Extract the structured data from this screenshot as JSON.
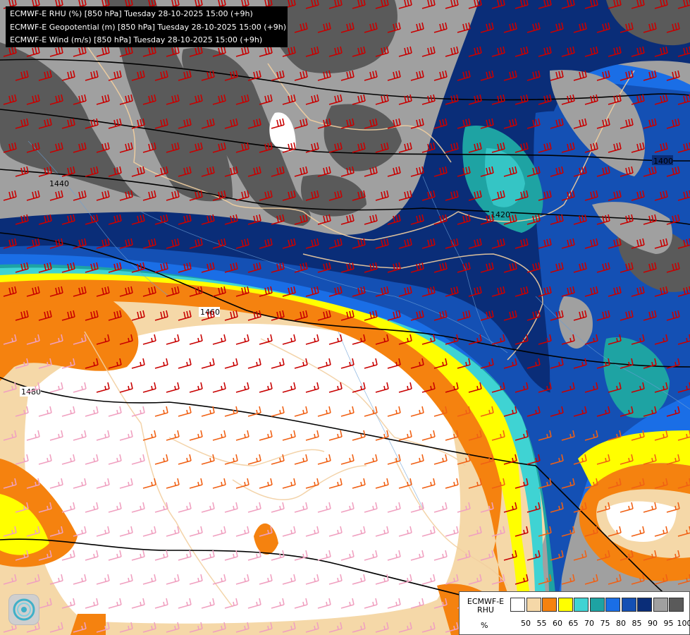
{
  "header": {
    "lines": [
      "ECMWF-E RHU (%) [850 hPa] Tuesday 28-10-2025 15:00 (+9h)",
      "ECMWF-E Geopotential (m) [850 hPa] Tuesday 28-10-2025 15:00 (+9h)",
      "ECMWF-E Wind (m/s) [850 hPa] Tuesday 28-10-2025 15:00 (+9h)"
    ]
  },
  "contour_labels": [
    "1400",
    "1420",
    "1440",
    "1460",
    "1480"
  ],
  "legend": {
    "title": "ECMWF-E RHU",
    "unit": "%",
    "ticks": [
      "50",
      "55",
      "60",
      "65",
      "70",
      "75",
      "80",
      "85",
      "90",
      "95",
      "100"
    ],
    "colors": [
      "#ffffff",
      "#f5d8a8",
      "#f5820f",
      "#ffff00",
      "#3fd3d3",
      "#1ea3a3",
      "#1a6ee6",
      "#1450b4",
      "#0a2d78",
      "#a0a0a0",
      "#5a5a5a"
    ]
  },
  "map": {
    "fill_colors": {
      "dry": "#ffffff",
      "peach": "#f5d8a8",
      "orange": "#f5820f",
      "yellow": "#ffff00",
      "cyan": "#3fd3d3",
      "teal": "#1ea3a3",
      "blue": "#1a6ee6",
      "mid_blue": "#1450b4",
      "navy": "#0a2d78",
      "light_gray": "#a0a0a0",
      "dark_gray": "#5a5a5a"
    },
    "barb_colors": [
      "#c80000",
      "#f06014",
      "#f0a0c0"
    ]
  },
  "logo": {
    "icon": "ecmwf-logo-icon"
  }
}
